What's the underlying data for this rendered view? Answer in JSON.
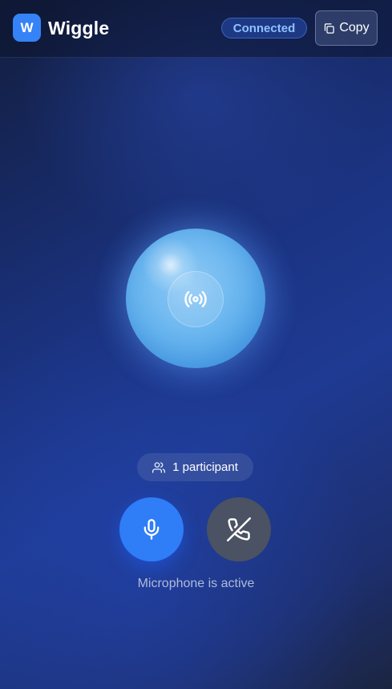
{
  "header": {
    "logo_letter": "W",
    "title": "Wiggle",
    "status": "Connected",
    "copy_label": "Copy"
  },
  "call": {
    "participants": "1 participant",
    "mic_status": "Microphone is active"
  },
  "icons": {
    "copy": "copy-icon",
    "broadcast": "broadcast-icon",
    "users": "users-icon",
    "mic": "mic-icon",
    "hangup": "phone-off-icon"
  },
  "colors": {
    "accent": "#2f7df7",
    "status_text": "#8ec1ff",
    "hangup_bg": "#4a5263",
    "orb": "#6ab6ef"
  }
}
